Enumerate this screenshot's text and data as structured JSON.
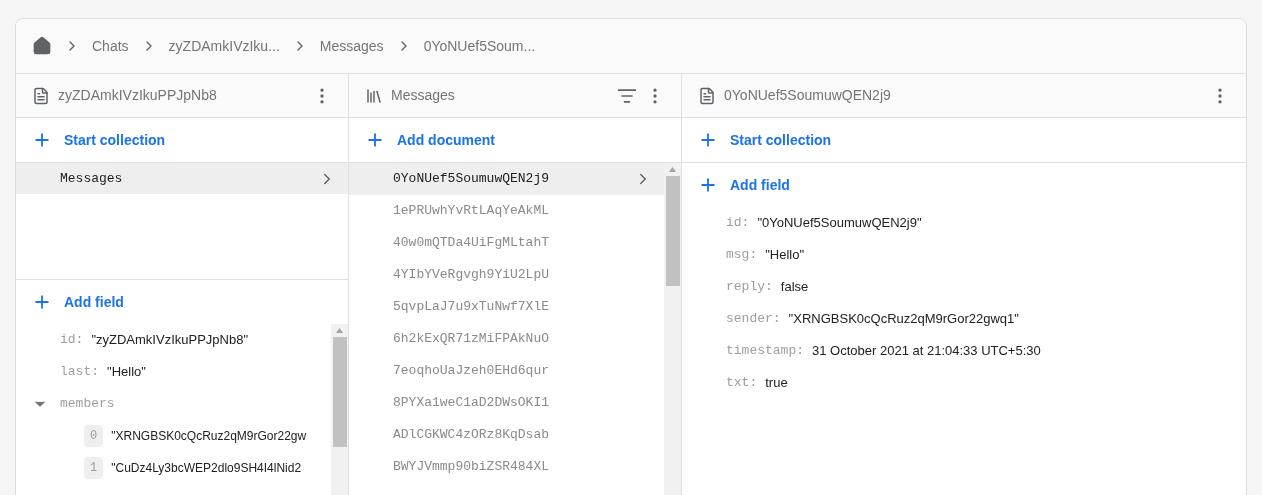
{
  "breadcrumb": [
    "Chats",
    "zyZDAmkIVzIku...",
    "Messages",
    "0YoNUef5Soum..."
  ],
  "columns": [
    {
      "kind": "document",
      "title": "zyZDAmkIVzIkuPPJpNb8",
      "action": "Start collection",
      "collections": [
        {
          "name": "Messages",
          "selected": true
        }
      ],
      "add_field": "Add field",
      "fields": [
        {
          "kind": "value",
          "key": "id:",
          "value": "\"zyZDAmkIVzIkuPPJpNb8\""
        },
        {
          "kind": "value",
          "key": "last:",
          "value": "\"Hello\""
        },
        {
          "kind": "array",
          "key": "members",
          "expanded": true,
          "children": [
            {
              "index": "0",
              "value": "\"XRNGBSK0cQcRuz2qM9rGor22gw"
            },
            {
              "index": "1",
              "value": "\"CuDz4Ly3bcWEP2dlo9SH4I4lNid2"
            }
          ]
        }
      ]
    },
    {
      "kind": "collection",
      "title": "Messages",
      "action": "Add document",
      "documents": [
        {
          "id": "0YoNUef5SoumuwQEN2j9",
          "selected": true
        },
        {
          "id": "1ePRUwhYvRtLAqYeAkML",
          "selected": false
        },
        {
          "id": "40w0mQTDa4UiFgMLtahT",
          "selected": false
        },
        {
          "id": "4YIbYVeRgvgh9YiU2LpU",
          "selected": false
        },
        {
          "id": "5qvpLaJ7u9xTuNwf7XlE",
          "selected": false
        },
        {
          "id": "6h2kExQR71zMiFPAkNuO",
          "selected": false
        },
        {
          "id": "7eoqhoUaJzeh0EHd6qur",
          "selected": false
        },
        {
          "id": "8PYXa1weC1aD2DWsOKI1",
          "selected": false
        },
        {
          "id": "ADlCGKWC4zORz8KqDsab",
          "selected": false
        },
        {
          "id": "BWYJVmmp90biZSR484XL",
          "selected": false
        }
      ]
    },
    {
      "kind": "document",
      "title": "0YoNUef5SoumuwQEN2j9",
      "action": "Start collection",
      "add_field": "Add field",
      "fields": [
        {
          "kind": "value",
          "key": "id:",
          "value": "\"0YoNUef5SoumuwQEN2j9\""
        },
        {
          "kind": "value",
          "key": "msg:",
          "value": "\"Hello\""
        },
        {
          "kind": "value",
          "key": "reply:",
          "value": "false"
        },
        {
          "kind": "value",
          "key": "sender:",
          "value": "\"XRNGBSK0cQcRuz2qM9rGor22gwq1\""
        },
        {
          "kind": "value",
          "key": "timestamp:",
          "value": "31 October 2021 at 21:04:33 UTC+5:30"
        },
        {
          "kind": "value",
          "key": "txt:",
          "value": "true"
        }
      ]
    }
  ]
}
